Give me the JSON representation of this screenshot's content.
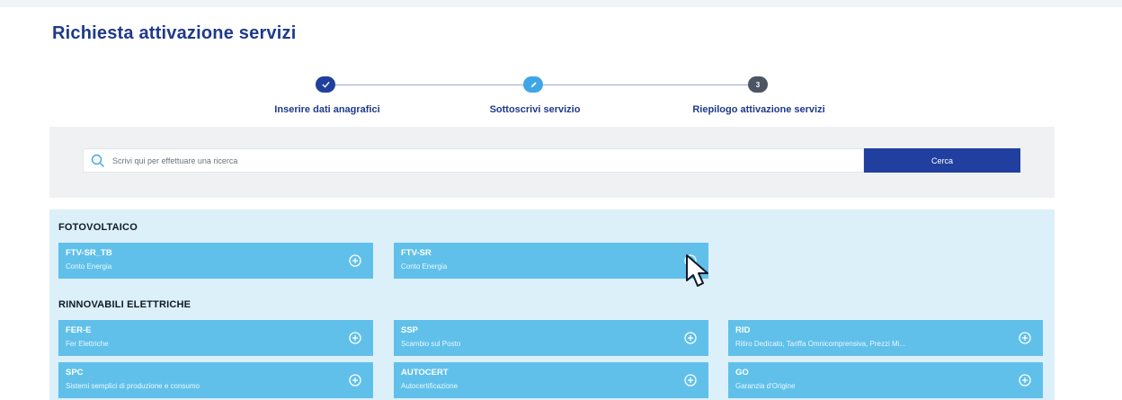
{
  "page_title": "Richiesta attivazione servizi",
  "stepper": {
    "steps": [
      {
        "label": "Inserire dati anagrafici",
        "status": "completed",
        "icon": "check-icon",
        "color": "#213f9e"
      },
      {
        "label": "Sottoscrivi servizio",
        "status": "current",
        "icon": "pencil-icon",
        "color": "#3ea6e6"
      },
      {
        "label": "Riepilogo attivazione servizi",
        "status": "pending",
        "number": "3",
        "color": "#4b5563"
      }
    ]
  },
  "search": {
    "placeholder": "Scrivi qui per effettuare una ricerca",
    "button_label": "Cerca"
  },
  "categories": [
    {
      "title": "FOTOVOLTAICO",
      "services": [
        {
          "name": "FTV-SR_TB",
          "description": "Conto Energia"
        },
        {
          "name": "FTV-SR",
          "description": "Conto Energia"
        }
      ]
    },
    {
      "title": "RINNOVABILI ELETTRICHE",
      "services": [
        {
          "name": "FER-E",
          "description": "Fer Elettriche"
        },
        {
          "name": "SSP",
          "description": "Scambio sul Posto"
        },
        {
          "name": "RID",
          "description": "Ritiro Dedicato, Tariffa Omnicomprensiva, Prezzi Mi..."
        },
        {
          "name": "SPC",
          "description": "Sistemi semplici di produzione e consumo"
        },
        {
          "name": "AUTOCERT",
          "description": "Autocertificazione"
        },
        {
          "name": "GO",
          "description": "Garanzia d'Origine"
        }
      ]
    }
  ],
  "colors": {
    "title": "#1e3a8a",
    "primary_button": "#213f9e",
    "card": "#60c0ea",
    "services_bg": "#dcf0fa",
    "search_panel_bg": "#f0f1f3"
  }
}
